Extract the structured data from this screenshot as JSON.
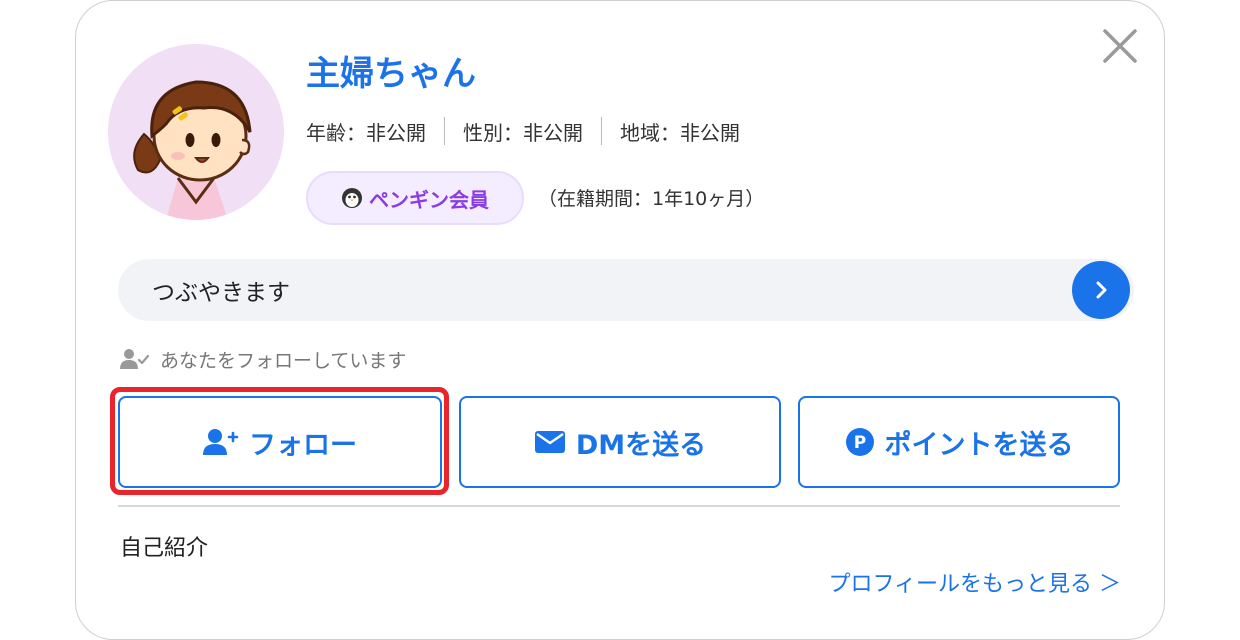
{
  "profile": {
    "name": "主婦ちゃん",
    "age": "年齢：非公開",
    "gender": "性別：非公開",
    "region": "地域：非公開",
    "badge_label": "ペンギン会員",
    "tenure": "（在籍期間：1年10ヶ月）"
  },
  "tweet_bar": {
    "label": "つぶやきます"
  },
  "follow_status": "あなたをフォローしています",
  "actions": {
    "follow_label": "フォロー",
    "dm_label": "DMを送る",
    "points_label": "ポイントを送る"
  },
  "intro": {
    "label": "自己紹介",
    "more_link": "プロフィールをもっと見る ＞"
  },
  "icons": {
    "close": "close-icon",
    "penguin": "penguin-icon",
    "arrow": "chevron-right-icon",
    "user_check": "user-check-icon",
    "user_plus": "user-plus-icon",
    "mail": "mail-icon",
    "point": "point-icon"
  },
  "colors": {
    "accent": "#1a73e8",
    "badge_text": "#8a3ae6",
    "badge_bg": "#f4ecff",
    "highlight": "#e8242c"
  }
}
